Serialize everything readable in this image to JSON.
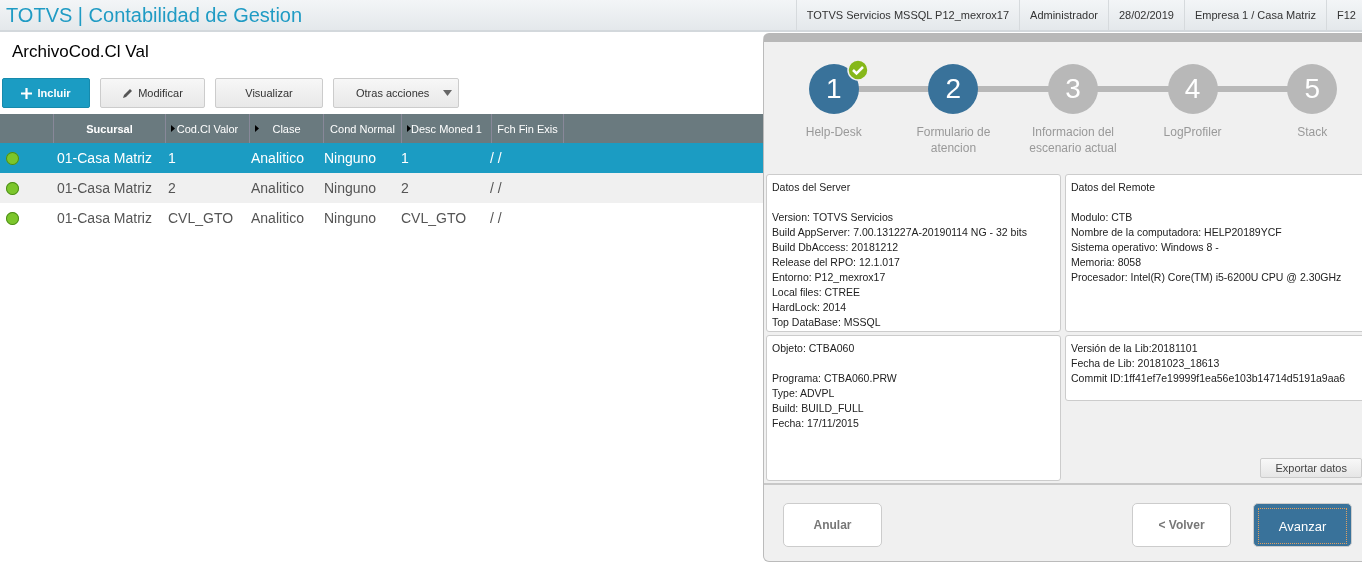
{
  "app_title": "TOTVS | Contabilidad de Gestion",
  "status_items": [
    "TOTVS Servicios MSSQL P12_mexrox17",
    "Administrador",
    "28/02/2019",
    "Empresa 1 / Casa Matriz",
    "F12"
  ],
  "page_title": "ArchivoCod.Cl Val",
  "toolbar": [
    {
      "label": "Incluir",
      "kind": "primary"
    },
    {
      "label": "Modificar",
      "kind": "edit"
    },
    {
      "label": "Visualizar",
      "kind": "plain"
    },
    {
      "label": "Otras acciones",
      "kind": "dropdown"
    }
  ],
  "table": {
    "columns": [
      {
        "label": "Sucursal",
        "arrow": false
      },
      {
        "label": "Cod.Cl Valor",
        "arrow": true
      },
      {
        "label": "Clase",
        "arrow": true
      },
      {
        "label": "Cond Normal",
        "arrow": false
      },
      {
        "label": "Desc Moned 1",
        "arrow": true
      },
      {
        "label": "Fch Fin Exis",
        "arrow": false
      }
    ],
    "rows": [
      {
        "selected": true,
        "color": "#7cc62c",
        "cells": [
          "01-Casa Matriz",
          "1",
          "Analitico",
          "Ninguno",
          "1",
          "/  /"
        ]
      },
      {
        "selected": false,
        "color": "#7cc62c",
        "cells": [
          "01-Casa Matriz",
          "2",
          "Analitico",
          "Ninguno",
          "2",
          "/  /"
        ]
      },
      {
        "selected": false,
        "color": "#7cc62c",
        "cells": [
          "01-Casa Matriz",
          "CVL_GTO",
          "Analitico",
          "Ninguno",
          "CVL_GTO",
          "/  /"
        ]
      }
    ]
  },
  "wizard": {
    "steps": [
      {
        "number": "1",
        "label": "Help-Desk",
        "reached": true,
        "completed": true
      },
      {
        "number": "2",
        "label": "Formulario de atencion",
        "reached": true,
        "completed": false
      },
      {
        "number": "3",
        "label": "Informacion del escenario actual",
        "reached": false,
        "completed": false
      },
      {
        "number": "4",
        "label": "LogProfiler",
        "reached": false,
        "completed": false
      },
      {
        "number": "5",
        "label": "Stack",
        "reached": false,
        "completed": false
      }
    ],
    "panels": [
      {
        "title": "Datos del Server",
        "lines": [
          "Version: TOTVS Servicios",
          "Build AppServer: 7.00.131227A-20190114 NG - 32 bits",
          "Build DbAccess: 20181212",
          "Release del RPO:  12.1.017",
          "Entorno: P12_mexrox17",
          "Local files: CTREE",
          "HardLock: 2014",
          "Top DataBase: MSSQL"
        ]
      },
      {
        "title": "Datos del Remote",
        "lines": [
          "Modulo: CTB",
          "Nombre de la computadora: HELP20189YCF",
          "Sistema operativo: Windows 8 -",
          "Memoria: 8058",
          "Procesador: Intel(R) Core(TM) i5-6200U CPU @ 2.30GHz"
        ]
      },
      {
        "title": "Objeto: CTBA060",
        "lines": [
          "Programa: CTBA060.PRW",
          "Type: ADVPL",
          "Build: BUILD_FULL",
          "Fecha: 17/11/2015"
        ]
      },
      {
        "lines": [
          "Versión de la Lib:20181101",
          "Fecha de Lib: 20181023_18613",
          "Commit ID:1ff41ef7e19999f1ea56e103b14714d5191a9aa6"
        ]
      }
    ],
    "export_button": "Exportar datos",
    "cancel_button": "Anular",
    "back_button": "< Volver",
    "next_button": "Avanzar"
  }
}
